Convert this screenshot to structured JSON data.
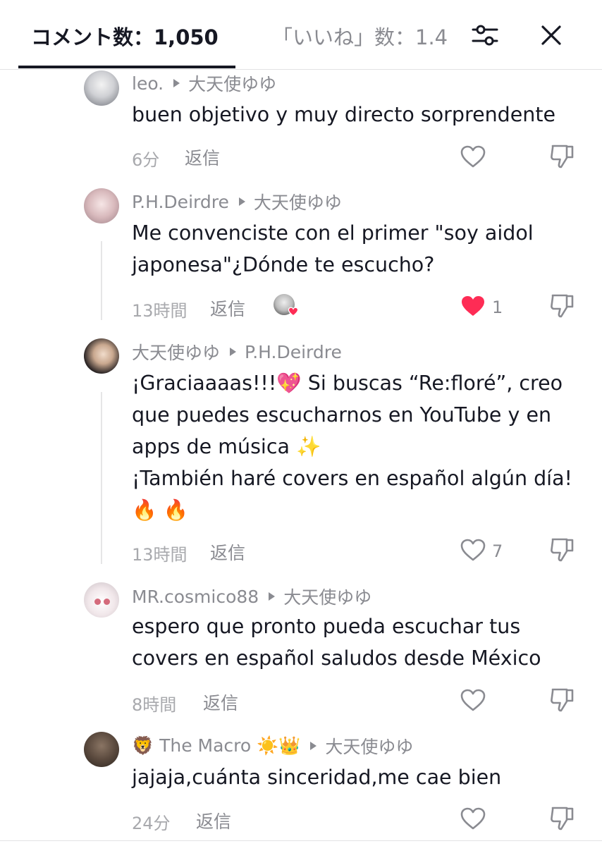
{
  "header": {
    "tab_comments": "コメント数：1,050",
    "tab_likes": "「いいね」数：1.4"
  },
  "icons": {
    "filter": "sliders-icon",
    "close": "close-icon",
    "like": "heart-outline-icon",
    "liked": "heart-filled-icon",
    "dislike": "thumbs-down-icon"
  },
  "colors": {
    "liked_red": "#fe2c55",
    "text": "#161823",
    "muted": "#8a8b91"
  },
  "comments": [
    {
      "user": "leo.",
      "reply_to": "大天使ゆゆ",
      "lines": [
        "buen objetivo y muy directo sorprendente"
      ],
      "time": "6分",
      "reply_label": "返信",
      "likes": ""
    },
    {
      "user": "P.H.Deirdre",
      "reply_to": "大天使ゆゆ",
      "lines": [
        "Me convenciste con el primer \"soy aidol",
        "japonesa\"¿Dónde te escucho?"
      ],
      "time": "13時間",
      "reply_label": "返信",
      "likes": "1"
    },
    {
      "user": "大天使ゆゆ",
      "reply_to": "P.H.Deirdre",
      "lines": [
        "¡Graciaaaas!!!💖 Si buscas “Re:floré”, creo",
        "que puedes escucharnos en YouTube y en",
        "apps de música ✨",
        "¡También haré covers en español algún día!",
        "🔥 🔥"
      ],
      "time": "13時間",
      "reply_label": "返信",
      "likes": "7"
    },
    {
      "user": "MR.cosmico88",
      "reply_to": "大天使ゆゆ",
      "lines": [
        "espero que pronto pueda escuchar tus",
        "covers en español saludos desde México"
      ],
      "time": "8時間",
      "reply_label": "返信",
      "likes": ""
    },
    {
      "user": "🦁 The  Macro  ☀️👑",
      "reply_to": "大天使ゆゆ",
      "lines": [
        "jajaja,cuánta sinceridad,me cae bien"
      ],
      "time": "24分",
      "reply_label": "返信",
      "likes": ""
    }
  ]
}
